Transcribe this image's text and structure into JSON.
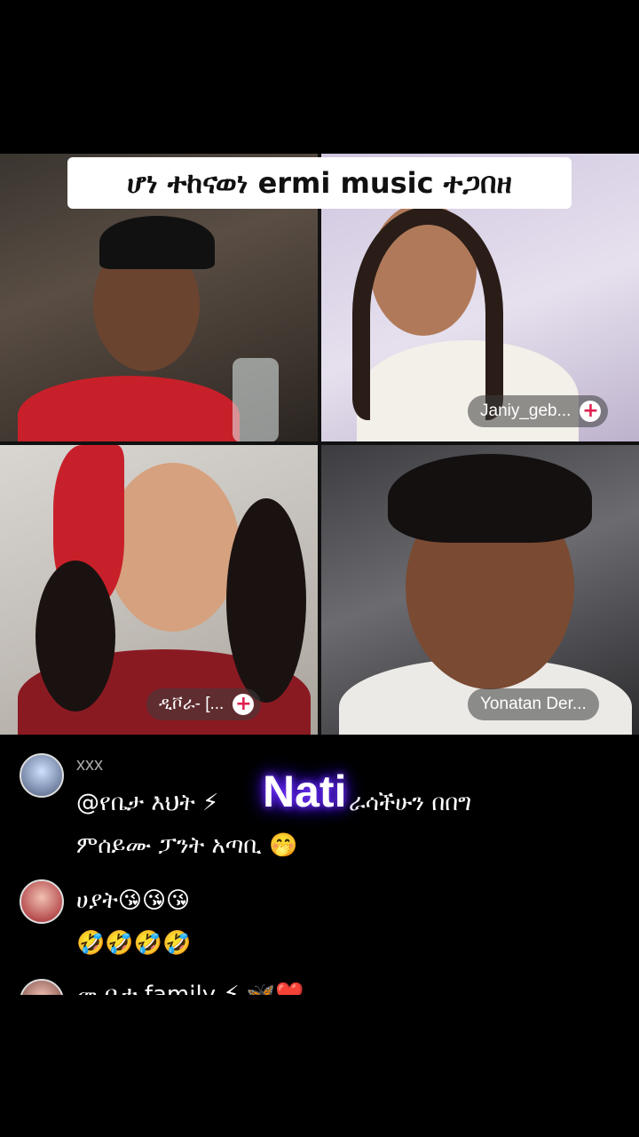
{
  "title_banner": "ሆነ ተከናወነ ermi music ተጋበዘ",
  "participants": [
    {
      "name": "",
      "tile": "top-left"
    },
    {
      "name": "Janiy_geb...",
      "tile": "top-right"
    },
    {
      "name": "ዲቮራ- [...",
      "tile": "bottom-left"
    },
    {
      "name": "Yonatan Der...",
      "tile": "bottom-right"
    }
  ],
  "overlay_label": "Nati",
  "comments": [
    {
      "user": "xxx",
      "line1_pre": "@የቤታ እህት ⚡",
      "line1_post": "ራሳችሁን በበግ",
      "line2": "ምሰይሙ ፓንት አጣቢ 🤭"
    },
    {
      "user": "",
      "line1": "ሀያት😘😘😘",
      "line2": "🤣🤣🤣🤣"
    },
    {
      "user": "",
      "line1": "መ ቤተ family ⚡ 🦋❤️"
    }
  ],
  "colors": {
    "accent_plus": "#e02050",
    "glow": "#5a1cff"
  }
}
